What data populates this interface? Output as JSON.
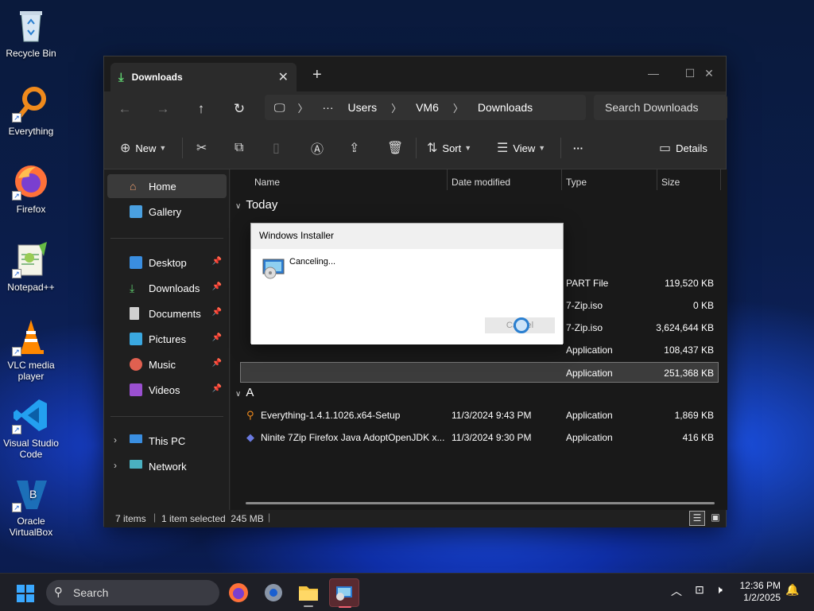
{
  "desktop": {
    "icons": [
      {
        "label": "Recycle Bin"
      },
      {
        "label": "Everything"
      },
      {
        "label": "Firefox"
      },
      {
        "label": "Notepad++"
      },
      {
        "label": "VLC media player"
      },
      {
        "label": "Visual Studio Code"
      },
      {
        "label": "Oracle VirtualBox"
      }
    ]
  },
  "window": {
    "tab_title": "Downloads",
    "breadcrumb": [
      "Users",
      "VM6",
      "Downloads"
    ],
    "search_placeholder": "Search Downloads",
    "toolbar": {
      "new_label": "New",
      "sort_label": "Sort",
      "view_label": "View",
      "more_label": "···",
      "details_label": "Details"
    },
    "sidebar": {
      "home": "Home",
      "gallery": "Gallery",
      "pinned": [
        "Desktop",
        "Downloads",
        "Documents",
        "Pictures",
        "Music",
        "Videos"
      ],
      "this_pc": "This PC",
      "network": "Network"
    },
    "columns": {
      "name": "Name",
      "date": "Date modified",
      "type": "Type",
      "size": "Size"
    },
    "groups": {
      "today": "Today",
      "earlier": "A"
    },
    "rows_today": [
      {
        "type": "PART File",
        "size": "119,520 KB"
      },
      {
        "type": "7-Zip.iso",
        "size": "0 KB"
      },
      {
        "type": "7-Zip.iso",
        "size": "3,624,644 KB"
      },
      {
        "type": "Application",
        "size": "108,437 KB"
      },
      {
        "type": "Application",
        "size": "251,368 KB"
      }
    ],
    "rows_earlier": [
      {
        "name": "Everything-1.4.1.1026.x64-Setup",
        "date": "11/3/2024 9:43 PM",
        "type": "Application",
        "size": "1,869 KB"
      },
      {
        "name": "Ninite 7Zip Firefox Java AdoptOpenJDK x...",
        "date": "11/3/2024 9:30 PM",
        "type": "Application",
        "size": "416 KB"
      }
    ],
    "status": {
      "items": "7 items",
      "selected": "1 item selected  245 MB"
    }
  },
  "dialog": {
    "title": "Windows Installer",
    "message": "Canceling...",
    "cancel_label": "Cancel"
  },
  "taskbar": {
    "search_label": "Search",
    "time": "12:36 PM",
    "date": "1/2/2025"
  },
  "colors": {
    "accent": "#1a5fd0",
    "window_bg": "#202020",
    "taskbar_bg": "#1e1f26"
  }
}
